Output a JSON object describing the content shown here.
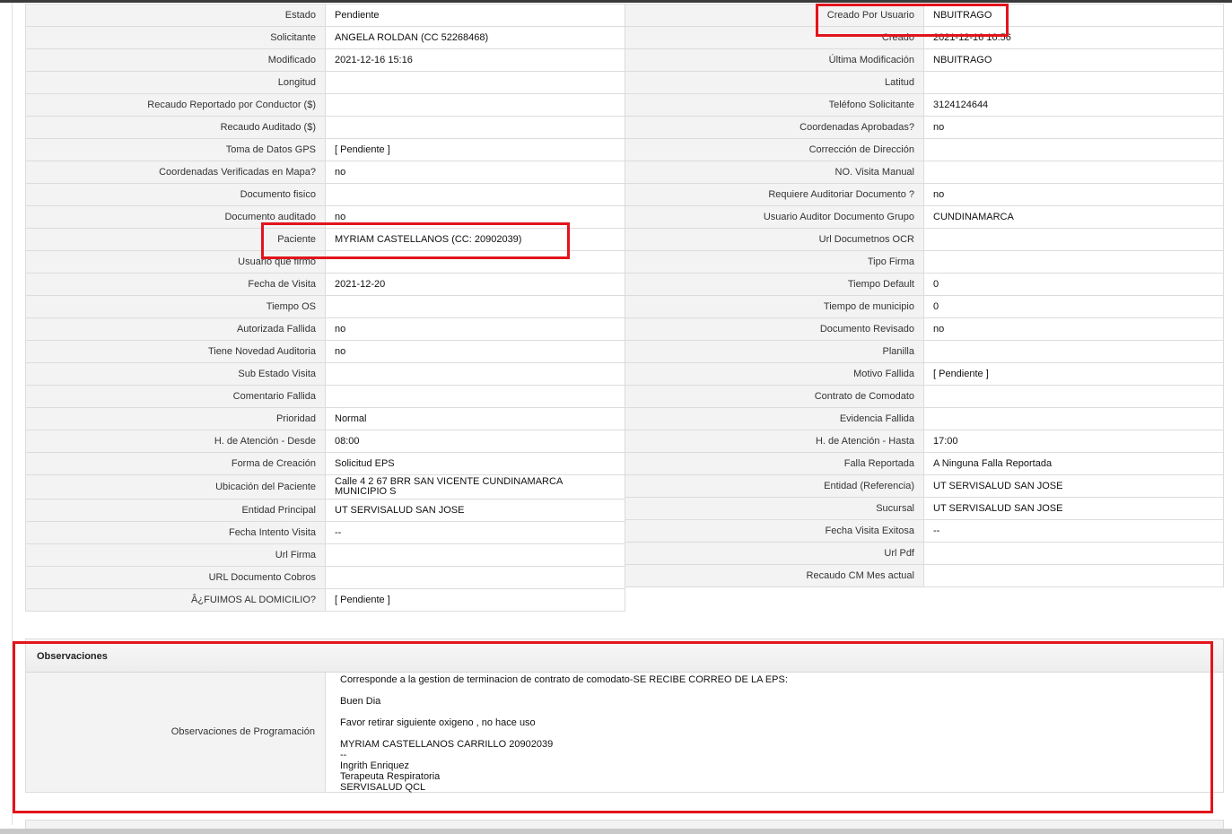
{
  "left_rows": [
    {
      "label": "Estado",
      "value": "Pendiente"
    },
    {
      "label": "Solicitante",
      "value": "ANGELA ROLDAN (CC 52268468)"
    },
    {
      "label": "Modificado",
      "value": "2021-12-16 15:16"
    },
    {
      "label": "Longitud",
      "value": ""
    },
    {
      "label": "Recaudo Reportado por Conductor ($)",
      "value": ""
    },
    {
      "label": "Recaudo Auditado ($)",
      "value": ""
    },
    {
      "label": "Toma de Datos GPS",
      "value": "[ Pendiente ]"
    },
    {
      "label": "Coordenadas Verificadas en Mapa?",
      "value": "no"
    },
    {
      "label": "Documento fisico",
      "value": ""
    },
    {
      "label": "Documento auditado",
      "value": "no"
    },
    {
      "label": "Paciente",
      "value": "MYRIAM CASTELLANOS (CC: 20902039)"
    },
    {
      "label": "Usuario que firmo",
      "value": ""
    },
    {
      "label": "Fecha de Visita",
      "value": "2021-12-20"
    },
    {
      "label": "Tiempo OS",
      "value": ""
    },
    {
      "label": "Autorizada Fallida",
      "value": "no"
    },
    {
      "label": "Tiene Novedad Auditoria",
      "value": "no"
    },
    {
      "label": "Sub Estado Visita",
      "value": ""
    },
    {
      "label": "Comentario Fallida",
      "value": ""
    },
    {
      "label": "Prioridad",
      "value": "Normal"
    },
    {
      "label": "H. de Atención - Desde",
      "value": "08:00"
    },
    {
      "label": "Forma de Creación",
      "value": "Solicitud EPS"
    },
    {
      "label": "Ubicación del Paciente",
      "value": "Calle 4 2 67 BRR SAN VICENTE CUNDINAMARCA MUNICIPIO S"
    },
    {
      "label": "Entidad Principal",
      "value": "UT SERVISALUD SAN JOSE"
    },
    {
      "label": "Fecha Intento Visita",
      "value": "--"
    },
    {
      "label": "Url Firma",
      "value": ""
    },
    {
      "label": "URL Documento Cobros",
      "value": ""
    },
    {
      "label": "Â¿FUIMOS AL DOMICILIO?",
      "value": "[ Pendiente ]"
    }
  ],
  "right_rows": [
    {
      "label": "Creado Por Usuario",
      "value": "NBUITRAGO"
    },
    {
      "label": "Creado",
      "value": "2021-12-16 10:56"
    },
    {
      "label": "Última Modificación",
      "value": "NBUITRAGO"
    },
    {
      "label": "Latitud",
      "value": ""
    },
    {
      "label": "Teléfono Solicitante",
      "value": "3124124644"
    },
    {
      "label": "Coordenadas Aprobadas?",
      "value": "no"
    },
    {
      "label": "Corrección de Dirección",
      "value": ""
    },
    {
      "label": "NO. Visita Manual",
      "value": ""
    },
    {
      "label": "Requiere Auditoriar Documento ?",
      "value": "no"
    },
    {
      "label": "Usuario Auditor Documento Grupo",
      "value": "CUNDINAMARCA"
    },
    {
      "label": "Url Documetnos OCR",
      "value": ""
    },
    {
      "label": "Tipo Firma",
      "value": ""
    },
    {
      "label": "Tiempo Default",
      "value": "0"
    },
    {
      "label": "Tiempo de municipio",
      "value": "0"
    },
    {
      "label": "Documento Revisado",
      "value": "no"
    },
    {
      "label": "Planilla",
      "value": ""
    },
    {
      "label": "Motivo Fallida",
      "value": "[ Pendiente ]"
    },
    {
      "label": "Contrato de Comodato",
      "value": ""
    },
    {
      "label": "Evidencia Fallida",
      "value": ""
    },
    {
      "label": "H. de Atención - Hasta",
      "value": "17:00"
    },
    {
      "label": "Falla Reportada",
      "value": "A Ninguna Falla Reportada"
    },
    {
      "label": "Entidad (Referencia)",
      "value": "UT SERVISALUD SAN JOSE"
    },
    {
      "label": "Sucursal",
      "value": "UT SERVISALUD SAN JOSE"
    },
    {
      "label": "Fecha Visita Exitosa",
      "value": "--"
    },
    {
      "label": "Url Pdf",
      "value": ""
    },
    {
      "label": "Recaudo CM Mes actual",
      "value": ""
    }
  ],
  "observaciones": {
    "section_title": "Observaciones",
    "label": "Observaciones de Programación",
    "lines": [
      "Corresponde a la gestion de terminacion de contrato de comodato-SE RECIBE CORREO DE LA EPS:",
      "",
      "Buen Dia",
      "",
      "Favor retirar siguiente oxigeno , no hace uso",
      "",
      "MYRIAM CASTELLANOS CARRILLO 20902039",
      "--",
      "Ingrith Enriquez",
      "Terapeuta Respiratoria",
      "SERVISALUD QCL"
    ]
  },
  "highlight_color": "#e3141b"
}
